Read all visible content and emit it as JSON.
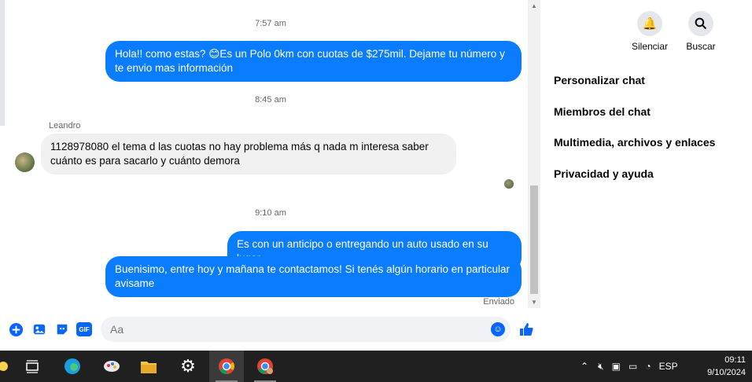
{
  "chat": {
    "time_1": "7:57 am",
    "msg_1": "Hola!! como estas? 😊Es un Polo 0km con cuotas de $275mil. Dejame tu número y te envio mas información",
    "time_2": "8:45 am",
    "sender": "Leandro",
    "msg_2": "1128978080 el tema d las cuotas no hay problema más q nada m interesa saber cuánto es para sacarlo y cuánto demora",
    "time_3": "9:10 am",
    "msg_3": "Es con un anticipo o entregando un auto usado en su lugar",
    "msg_4": "Buenisimo, entre hoy y mañana te contactamos! Si tenés algún horario en particular avisame",
    "status": "Enviado"
  },
  "composer": {
    "placeholder": "Aa",
    "icons": [
      "plus-icon",
      "image-icon",
      "sticker-icon",
      "gif-icon",
      "emoji-icon",
      "like-icon"
    ],
    "gif_label": "GIF"
  },
  "panel": {
    "mute_label": "Silenciar",
    "search_label": "Buscar",
    "items": [
      "Personalizar chat",
      "Miembros del chat",
      "Multimedia, archivos y enlaces",
      "Privacidad y ayuda"
    ]
  },
  "taskbar": {
    "language": "ESP",
    "time": "09:11",
    "date": "9/10/2024"
  },
  "colors": {
    "accent": "#0a7cff",
    "incoming": "#f0f0f0",
    "taskbar": "#202020"
  }
}
